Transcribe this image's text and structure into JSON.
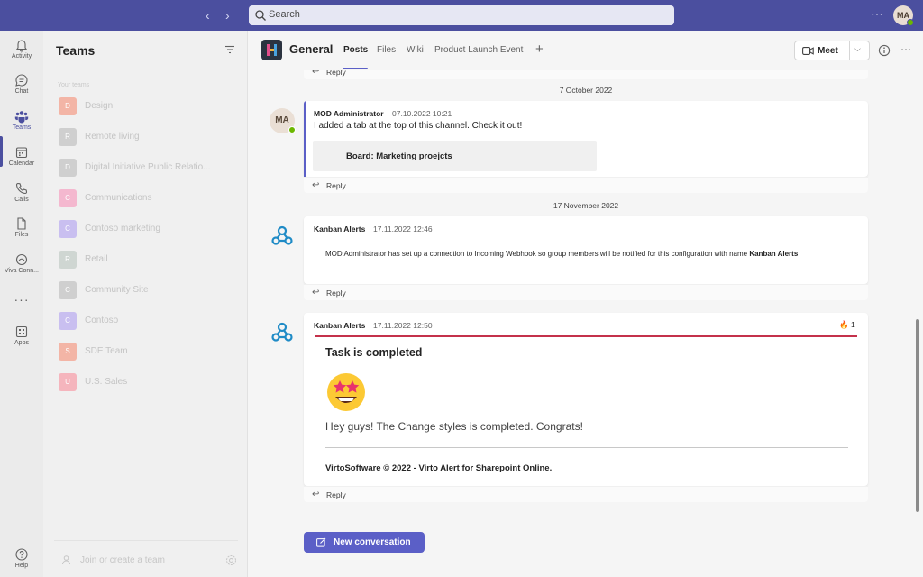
{
  "search": {
    "placeholder": "Search"
  },
  "user": {
    "initials": "MA"
  },
  "rail": {
    "items": [
      {
        "label": "Activity",
        "icon": "bell-icon"
      },
      {
        "label": "Chat",
        "icon": "chat-icon"
      },
      {
        "label": "Teams",
        "icon": "teams-icon"
      },
      {
        "label": "Calendar",
        "icon": "calendar-icon"
      },
      {
        "label": "Calls",
        "icon": "phone-icon"
      },
      {
        "label": "Files",
        "icon": "file-icon"
      },
      {
        "label": "Viva Conn...",
        "icon": "viva-icon"
      },
      {
        "label": "Apps",
        "icon": "apps-icon"
      },
      {
        "label": "Help",
        "icon": "help-icon"
      }
    ],
    "more": "···"
  },
  "teams_panel": {
    "title": "Teams",
    "section": "Your teams",
    "teams": [
      {
        "name": "Design",
        "initials": "D",
        "color": "#f3b5a6"
      },
      {
        "name": "Remote living",
        "initials": "R",
        "color": "#cfcfcf"
      },
      {
        "name": "Digital Initiative Public Relatio...",
        "initials": "D",
        "color": "#cfcfcf"
      },
      {
        "name": "Communications",
        "initials": "C",
        "color": "#f4b8cf"
      },
      {
        "name": "Contoso marketing",
        "initials": "C",
        "color": "#c9bff0"
      },
      {
        "name": "Retail",
        "initials": "R",
        "color": "#cfd6d2"
      },
      {
        "name": "Community Site",
        "initials": "C",
        "color": "#cfcfcf"
      },
      {
        "name": "Contoso",
        "initials": "C",
        "color": "#c9bff0"
      },
      {
        "name": "SDE Team",
        "initials": "S",
        "color": "#f3b5a6"
      },
      {
        "name": "U.S. Sales",
        "initials": "U",
        "color": "#f5b5bd"
      }
    ],
    "join": "Join or create a team"
  },
  "channel": {
    "name": "General",
    "tabs": [
      "Posts",
      "Files",
      "Wiki",
      "Product Launch Event"
    ],
    "meet_label": "Meet"
  },
  "posts": {
    "reply_label": "Reply",
    "date1": "7 October 2022",
    "date2": "17 November 2022",
    "post1": {
      "author": "MOD Administrator",
      "time": "07.10.2022 10:21",
      "text": "I added a tab at the top of this channel. Check it out!",
      "tab_card": "Board: Marketing proejcts"
    },
    "post2": {
      "author": "Kanban Alerts",
      "time": "17.11.2022 12:46",
      "text": "MOD Administrator has set up a connection to Incoming Webhook so group members will be notified for this configuration with name",
      "name_bold": "Kanban Alerts"
    },
    "post3": {
      "author": "Kanban Alerts",
      "time": "17.11.2022 12:50",
      "reaction_count": "1",
      "card_title": "Task is completed",
      "card_body": "Hey guys! The Change styles is completed. Congrats!",
      "card_footer": "VirtoSoftware © 2022 - Virto Alert for Sharepoint Online."
    },
    "new_conversation": "New conversation"
  },
  "colors": {
    "brand": "#4b4f9f",
    "accent": "#5b5fc7",
    "alert": "#c4314b",
    "presence": "#6bb700"
  }
}
